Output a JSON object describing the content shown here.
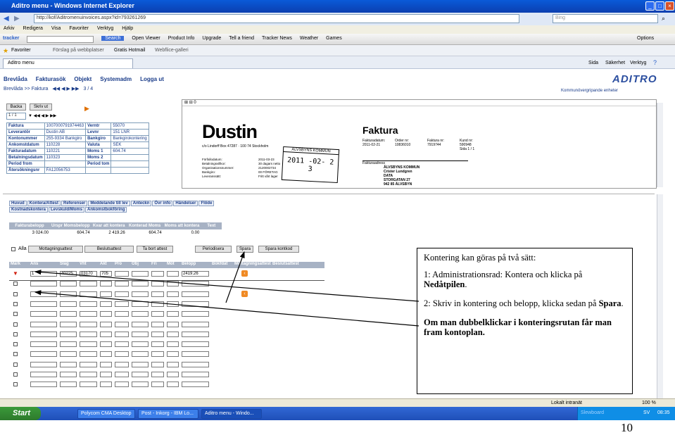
{
  "window": {
    "title": "Aditro menu - Windows Internet Explorer",
    "btn_min": "_",
    "btn_max": "□",
    "btn_close": "×"
  },
  "address": {
    "url": "http://kof/Aditromenuinvoices.aspx?id=793261269",
    "search_placeholder": "Bing"
  },
  "menu": [
    "Arkiv",
    "Redigera",
    "Visa",
    "Favoriter",
    "Verktyg",
    "Hjälp"
  ],
  "toolbar": {
    "tracker": "tracker",
    "search": "Search",
    "items": [
      "Open Viewer",
      "Product Info",
      "Upgrade",
      "Tell a friend",
      "Tracker News",
      "Weather",
      "Games"
    ],
    "options": "Options"
  },
  "favorites": {
    "label": "Favoriter",
    "items": [
      "Förslag på webbplatser",
      "Gratis Hotmail",
      "Webflice-galleri"
    ]
  },
  "tab": {
    "label": "Aditro menu",
    "cmds": [
      "Sida",
      "Säkerhet",
      "Verktyg"
    ]
  },
  "app": {
    "nav": [
      "Brevlåda",
      "Fakturasök",
      "Objekt",
      "Systemadm",
      "Logga ut"
    ],
    "breadcrumb": "Brevlåda >> Faktura",
    "pager": "3 / 4",
    "logo": "ADITRO",
    "logo_sub": "Kommunövergripande enheter",
    "btn_back": "Backa",
    "btn_print": "Skriv ut",
    "page_select": "1 / 1",
    "info": [
      [
        "Faktura",
        "1007000791974463",
        "Verntr",
        "55070"
      ],
      [
        "Leverantör",
        "Dustin AB",
        "Levnr",
        "151 LNR"
      ],
      [
        "Kontonummer",
        "255-9334 Bankgiro",
        "Bankgiro",
        "Bankgirokontering"
      ],
      [
        "Ankomstdatum",
        "110228",
        "Valuta",
        "SEK"
      ],
      [
        "Fakturadatum",
        "110221",
        "Moms 1",
        "604.74"
      ],
      [
        "Betalningsdatum",
        "110323",
        "Moms 2",
        ""
      ],
      [
        "Period from",
        "",
        "Period tom",
        ""
      ],
      [
        "Återsökningsnr",
        "FA12056753",
        "",
        ""
      ]
    ]
  },
  "invoice": {
    "zoom": "0",
    "company": "Dustin",
    "company_addr": "c/o Lindorff Box 47287 · 100 74 Stockholm",
    "doc_title": "Faktura",
    "heads": [
      "Fakturadatum:",
      "Order nr:",
      "Faktura nr:",
      "Kund nr:"
    ],
    "vals": [
      "2011-02-21",
      "10836010",
      "7919744",
      "590948"
    ],
    "page": "Sida 1 / 1",
    "stamp_org": "ÅLVSBYNS KOMMUN",
    "stamp_date": "2011 -02- 2 3",
    "terms_labels": [
      "Förfallodatum:",
      "Betalningsvillkor:",
      "Organisationsnummer:",
      "Bankgiro:",
      "Leveranssätt:"
    ],
    "terms_vals": [
      "2011-03-23",
      "30 dagars netto",
      "2120002734",
      "00 FÖRETAG",
      "Fritt vårt lager"
    ],
    "addr_title": "Fakturaadress",
    "addr": [
      "ÅLVSBYNS KOMMUN",
      "Crister Lundgren",
      "DATA",
      "STORGATAN 27",
      "942 85 ÄLVSBYN"
    ]
  },
  "tabs1": [
    "Huvud",
    "Kontera/Attest",
    "Referenser",
    "Meddelande till lev",
    "Anteckn",
    "Övr info",
    "Händelser",
    "Flöde"
  ],
  "tabs2": [
    "Kostnadskontera",
    "Levskuld/Moms",
    "Ankomstbokföring"
  ],
  "summary": {
    "headers": [
      "Fakturabelopp",
      "Urspr Momsbelopp",
      "Kvar att kontera",
      "Konterad Moms",
      "Moms att kontera",
      "Text"
    ],
    "values": [
      "3 024.00",
      "604.74",
      "2 419.26",
      "604.74",
      "0.00",
      ""
    ]
  },
  "actions": {
    "all": "Alla",
    "buttons": [
      "Mottagningsattest",
      "Beslutsattest",
      "Ta bort attest",
      "Periodisera",
      "Spara",
      "Spara kontkod"
    ]
  },
  "grid": {
    "headers": [
      "Mark",
      "Ans",
      "Slag",
      "Vht",
      "Akt",
      "Pro",
      "Obj",
      "Fri",
      "Mot",
      "Belopp",
      "Bokfdat",
      "Mottagningsattest",
      "Beslutsattest"
    ],
    "row1": [
      "1",
      "40225",
      "03170",
      "705",
      "",
      "",
      "",
      "2419.26"
    ]
  },
  "callout": {
    "line1": "Kontering kan göras på två sätt:",
    "line2a": "1: Administrationsrad: Kontera och klicka på ",
    "line2b": "Nedåtpilen",
    "line2c": ".",
    "line3a": "2: Skriv in kontering och belopp, klicka sedan på ",
    "line3b": "Spara",
    "line3c": ".",
    "line4": "Om man dubbelklickar i konteringsrutan får man fram kontoplan."
  },
  "status": {
    "zone": "Lokalt intranät",
    "zoom": "100 %"
  },
  "taskbar": {
    "start": "Start",
    "items": [
      "Polycom CMA Desktop",
      "Post - Inkorg - IBM Lo...",
      "Aditro menu - Windo..."
    ],
    "lang": "SV",
    "clock": "08:35",
    "tray": "Slewboard"
  },
  "page_number": "10"
}
